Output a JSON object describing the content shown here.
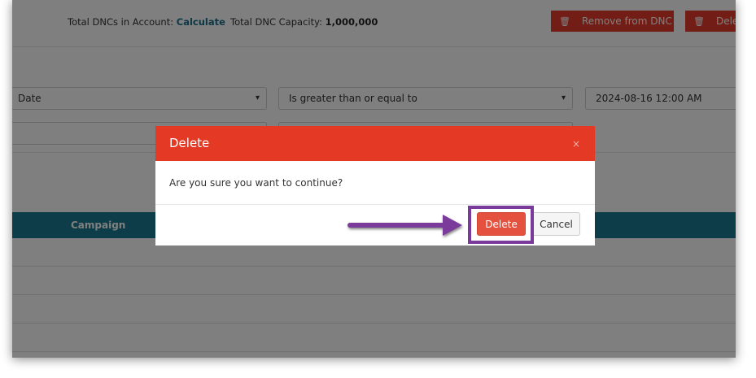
{
  "header": {
    "dnc_count_label": "Total DNCs in Account:",
    "dnc_count_link": "Calculate",
    "capacity_label": "Total DNC Capacity:",
    "capacity_value": "1,000,000",
    "remove_button_label": "Remove from DNC",
    "delete_button_label": "Dele"
  },
  "filters": {
    "field_select": "Date",
    "operator_select": "Is greater than or equal to",
    "value_input": "2024-08-16 12:00 AM"
  },
  "table": {
    "columns": [
      "Campaign"
    ]
  },
  "modal": {
    "title": "Delete",
    "close_glyph": "×",
    "message": "Are you sure you want to continue?",
    "confirm_label": "Delete",
    "cancel_label": "Cancel"
  },
  "annotation": {
    "color": "#7a3a9a"
  }
}
